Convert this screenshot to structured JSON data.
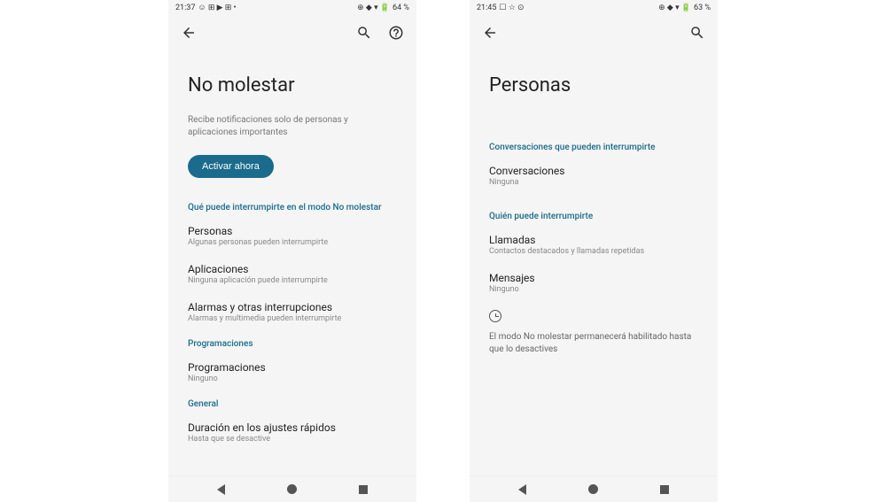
{
  "left": {
    "statusBar": {
      "time": "21:37",
      "leftIcons": "☺ ⊞ ▶ ⊞ •",
      "rightIcons": "⊕ ◆ ▾ 🔋",
      "battery": "64 %"
    },
    "title": "No molestar",
    "subtitle": "Recibe notificaciones solo de personas y aplicaciones importantes",
    "activateBtn": "Activar ahora",
    "section1": {
      "header": "Qué puede interrumpirte en el modo No molestar",
      "items": [
        {
          "title": "Personas",
          "subtitle": "Algunas personas pueden interrumpirte"
        },
        {
          "title": "Aplicaciones",
          "subtitle": "Ninguna aplicación puede interrumpirte"
        },
        {
          "title": "Alarmas y otras interrupciones",
          "subtitle": "Alarmas y multimedia pueden interrumpirte"
        }
      ]
    },
    "section2": {
      "header": "Programaciones",
      "items": [
        {
          "title": "Programaciones",
          "subtitle": "Ninguno"
        }
      ]
    },
    "section3": {
      "header": "General",
      "items": [
        {
          "title": "Duración en los ajustes rápidos",
          "subtitle": "Hasta que se desactive"
        }
      ]
    }
  },
  "right": {
    "statusBar": {
      "time": "21:45",
      "leftIcons": "☐ ☆ ⊙",
      "rightIcons": "⊕ ◆ ▾ 🔋",
      "battery": "63 %"
    },
    "title": "Personas",
    "section1": {
      "header": "Conversaciones que pueden interrumpirte",
      "items": [
        {
          "title": "Conversaciones",
          "subtitle": "Ninguna"
        }
      ]
    },
    "section2": {
      "header": "Quién puede interrumpirte",
      "items": [
        {
          "title": "Llamadas",
          "subtitle": "Contactos destacados y llamadas repetidas"
        },
        {
          "title": "Mensajes",
          "subtitle": "Ninguno"
        }
      ]
    },
    "infoText": "El modo No molestar permanecerá habilitado hasta que lo desactives"
  }
}
